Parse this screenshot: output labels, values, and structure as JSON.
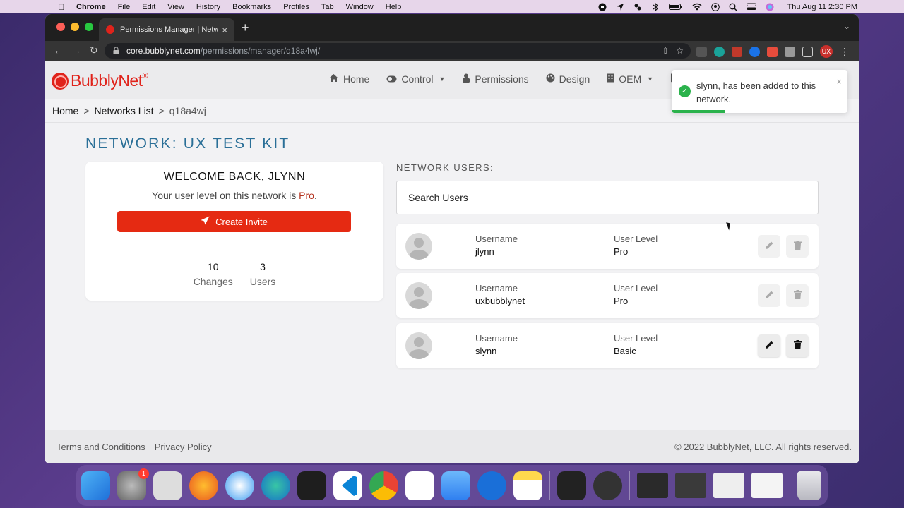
{
  "menubar": {
    "apple_icon": "apple-icon",
    "items": [
      "Chrome",
      "File",
      "Edit",
      "View",
      "History",
      "Bookmarks",
      "Profiles",
      "Tab",
      "Window",
      "Help"
    ],
    "clock": "Thu Aug 11  2:30 PM"
  },
  "browser": {
    "tab_title": "Permissions Manager | Network",
    "tab_close": "×",
    "new_tab": "+",
    "url_host": "core.bubblynet.com",
    "url_path": "/permissions/manager/q18a4wj/",
    "profile_initials": "UX"
  },
  "site": {
    "logo_text": "BubblyNet",
    "logo_reg": "®",
    "nav": [
      {
        "label": "Home",
        "icon": "home-icon",
        "has_caret": false
      },
      {
        "label": "Control",
        "icon": "toggle-icon",
        "has_caret": true
      },
      {
        "label": "Permissions",
        "icon": "user-lock-icon",
        "has_caret": false
      },
      {
        "label": "Design",
        "icon": "palette-icon",
        "has_caret": false
      },
      {
        "label": "OEM",
        "icon": "building-icon",
        "has_caret": true
      }
    ]
  },
  "breadcrumb": {
    "items": [
      "Home",
      "Networks List"
    ],
    "separator": ">",
    "current": "q18a4wj"
  },
  "network": {
    "title": "NETWORK: UX TEST KIT"
  },
  "welcome": {
    "heading": "WELCOME BACK, JLYNN",
    "level_prefix": "Your user level on this network is ",
    "level_value": "Pro",
    "level_suffix": ".",
    "invite_label": "Create Invite",
    "stats": [
      {
        "value": "10",
        "label": "Changes"
      },
      {
        "value": "3",
        "label": "Users"
      }
    ]
  },
  "users": {
    "heading": "NETWORK USERS:",
    "search_placeholder": "Search Users",
    "username_key": "Username",
    "level_key": "User Level",
    "rows": [
      {
        "username": "jlynn",
        "level": "Pro"
      },
      {
        "username": "uxbubblynet",
        "level": "Pro"
      },
      {
        "username": "slynn",
        "level": "Basic"
      }
    ]
  },
  "toast": {
    "message": "slynn, has been added to this network.",
    "close": "×",
    "progress": 0.3
  },
  "footer": {
    "links": [
      "Terms and Conditions",
      "Privacy Policy"
    ],
    "copyright": "© 2022 BubblyNet, LLC. All rights reserved."
  },
  "dock": {
    "badge_count": "1",
    "apps": [
      "finder-icon",
      "system-preferences-icon",
      "launchpad-icon",
      "firefox-icon",
      "safari-icon",
      "edge-icon",
      "terminal-icon",
      "vscode-icon",
      "chrome-icon",
      "slack-icon",
      "mail-icon",
      "sourcetree-icon",
      "notes-icon",
      "audio-app-icon",
      "quicktime-icon",
      "window-thumbnail-icon",
      "window-thumbnail-icon",
      "window-thumbnail-icon",
      "window-thumbnail-icon",
      "trash-icon"
    ]
  },
  "colors": {
    "brand_red": "#e0231b",
    "invite_red": "#e52a12",
    "title_blue": "#2a6f97",
    "success_green": "#2bb24c"
  }
}
